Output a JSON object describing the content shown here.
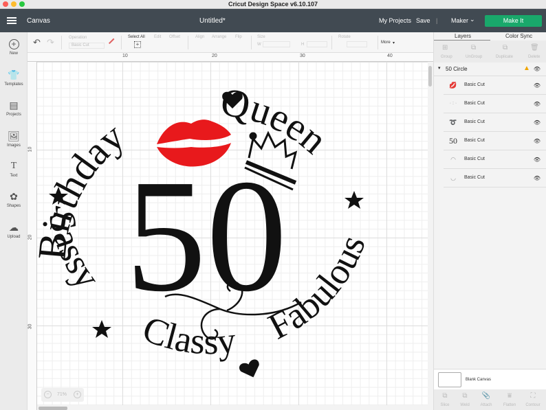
{
  "window": {
    "title": "Cricut Design Space  v6.10.107"
  },
  "header": {
    "section": "Canvas",
    "doc_title": "Untitled*",
    "my_projects": "My Projects",
    "save": "Save",
    "divider": "|",
    "machine": "Maker",
    "make_it": "Make It"
  },
  "toolbar": {
    "operation_label": "Operation",
    "operation_value": "Basic Cut",
    "select_all": "Select All",
    "edit": "Edit",
    "offset": "Offset",
    "align": "Align",
    "arrange": "Arrange",
    "flip": "Flip",
    "size": "Size",
    "w": "W",
    "h": "H",
    "rotate": "Rotate",
    "more": "More"
  },
  "sidebar": {
    "items": [
      {
        "label": "New",
        "icon": "+"
      },
      {
        "label": "Templates",
        "icon": "👕"
      },
      {
        "label": "Projects",
        "icon": "▤"
      },
      {
        "label": "Images",
        "icon": "🖼"
      },
      {
        "label": "Text",
        "icon": "T"
      },
      {
        "label": "Shapes",
        "icon": "✿"
      },
      {
        "label": "Upload",
        "icon": "☁"
      }
    ]
  },
  "rulers": {
    "top": [
      "10",
      "20",
      "30",
      "40"
    ],
    "left": [
      "10",
      "20",
      "30"
    ]
  },
  "zoom": {
    "minus": "−",
    "value": "71%",
    "plus": "+"
  },
  "design": {
    "top_text_1": "Birthday",
    "top_text_2": "Queen",
    "bottom_text_1": "Sassy",
    "bottom_text_2": "Classy",
    "bottom_text_3": "Fabulous",
    "number": "50",
    "lips_color": "#e8191c",
    "ink_color": "#111111"
  },
  "panel": {
    "tabs": [
      "Layers",
      "Color Sync"
    ],
    "tools": [
      "Group",
      "UnGroup",
      "Duplicate",
      "Delete"
    ],
    "group_name": "50 Circle",
    "layers": [
      {
        "label": "Basic Cut",
        "thumb": "lips"
      },
      {
        "label": "Basic Cut",
        "thumb": "dots"
      },
      {
        "label": "Basic Cut",
        "thumb": "swirl"
      },
      {
        "label": "Basic Cut",
        "thumb": "50"
      },
      {
        "label": "Basic Cut",
        "thumb": "arc-top"
      },
      {
        "label": "Basic Cut",
        "thumb": "arc-bottom"
      }
    ],
    "blank_canvas": "Blank Canvas",
    "bottom_tools": [
      "Slice",
      "Weld",
      "Attach",
      "Flatten",
      "Contour"
    ]
  },
  "colors": {
    "header": "#414a52",
    "make_it": "#19a86b",
    "warning": "#f0a500"
  }
}
